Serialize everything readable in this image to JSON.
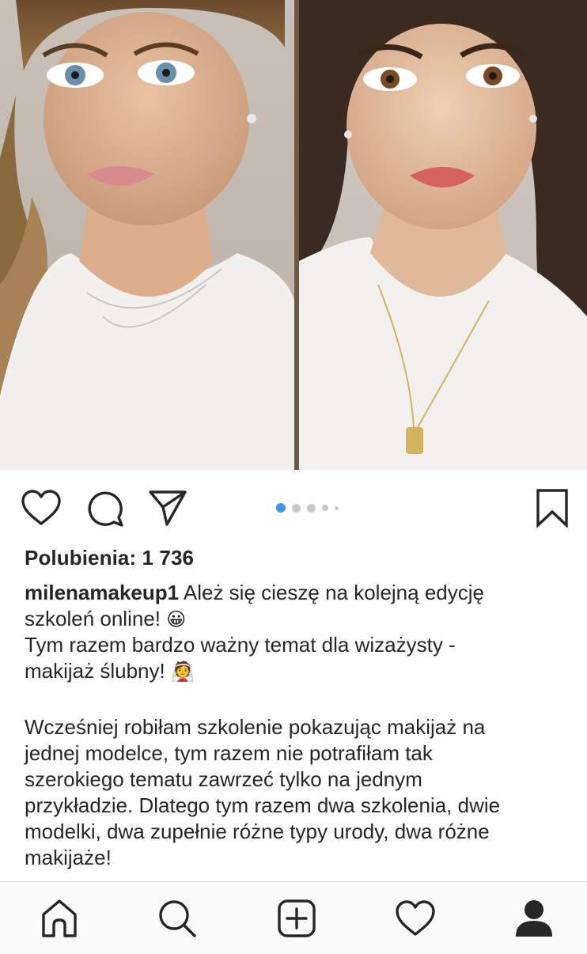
{
  "post": {
    "likes_label": "Polubienia: 1 736",
    "username": "milenamakeup1",
    "caption_line1_rest": " Ależ się cieszę na kolejną edycję",
    "caption_line2": "szkoleń online! ",
    "caption_line2_emoji": "😀",
    "caption_line3": "Tym razem bardzo ważny temat dla wizażysty -",
    "caption_line4": "makijaż ślubny! ",
    "caption_line4_emoji": "👰",
    "caption_p2_line1": "Wcześniej robiłam szkolenie pokazując makijaż na",
    "caption_p2_line2": "jednej modelce, tym razem nie potrafiłam tak",
    "caption_p2_line3": "szerokiego tematu zawrzeć tylko na jednym",
    "caption_p2_line4": "przykładzie. Dlatego tym razem dwa szkolenia, dwie",
    "caption_p2_line5": "modelki, dwa zupełnie różne typy urody, dwa różne",
    "caption_p2_line6": "makijaże!"
  },
  "carousel": {
    "total_images": 5,
    "active_index": 0,
    "active_color": "#3897f0"
  },
  "icons": {
    "like": "heart-icon",
    "comment": "comment-bubble-icon",
    "share": "paper-plane-icon",
    "save": "bookmark-icon",
    "home": "home-icon",
    "search": "search-icon",
    "new_post": "plus-square-icon",
    "activity": "heart-icon",
    "profile": "profile-icon"
  },
  "colors": {
    "text": "#262626",
    "tabbar_bg": "#fafafa"
  }
}
